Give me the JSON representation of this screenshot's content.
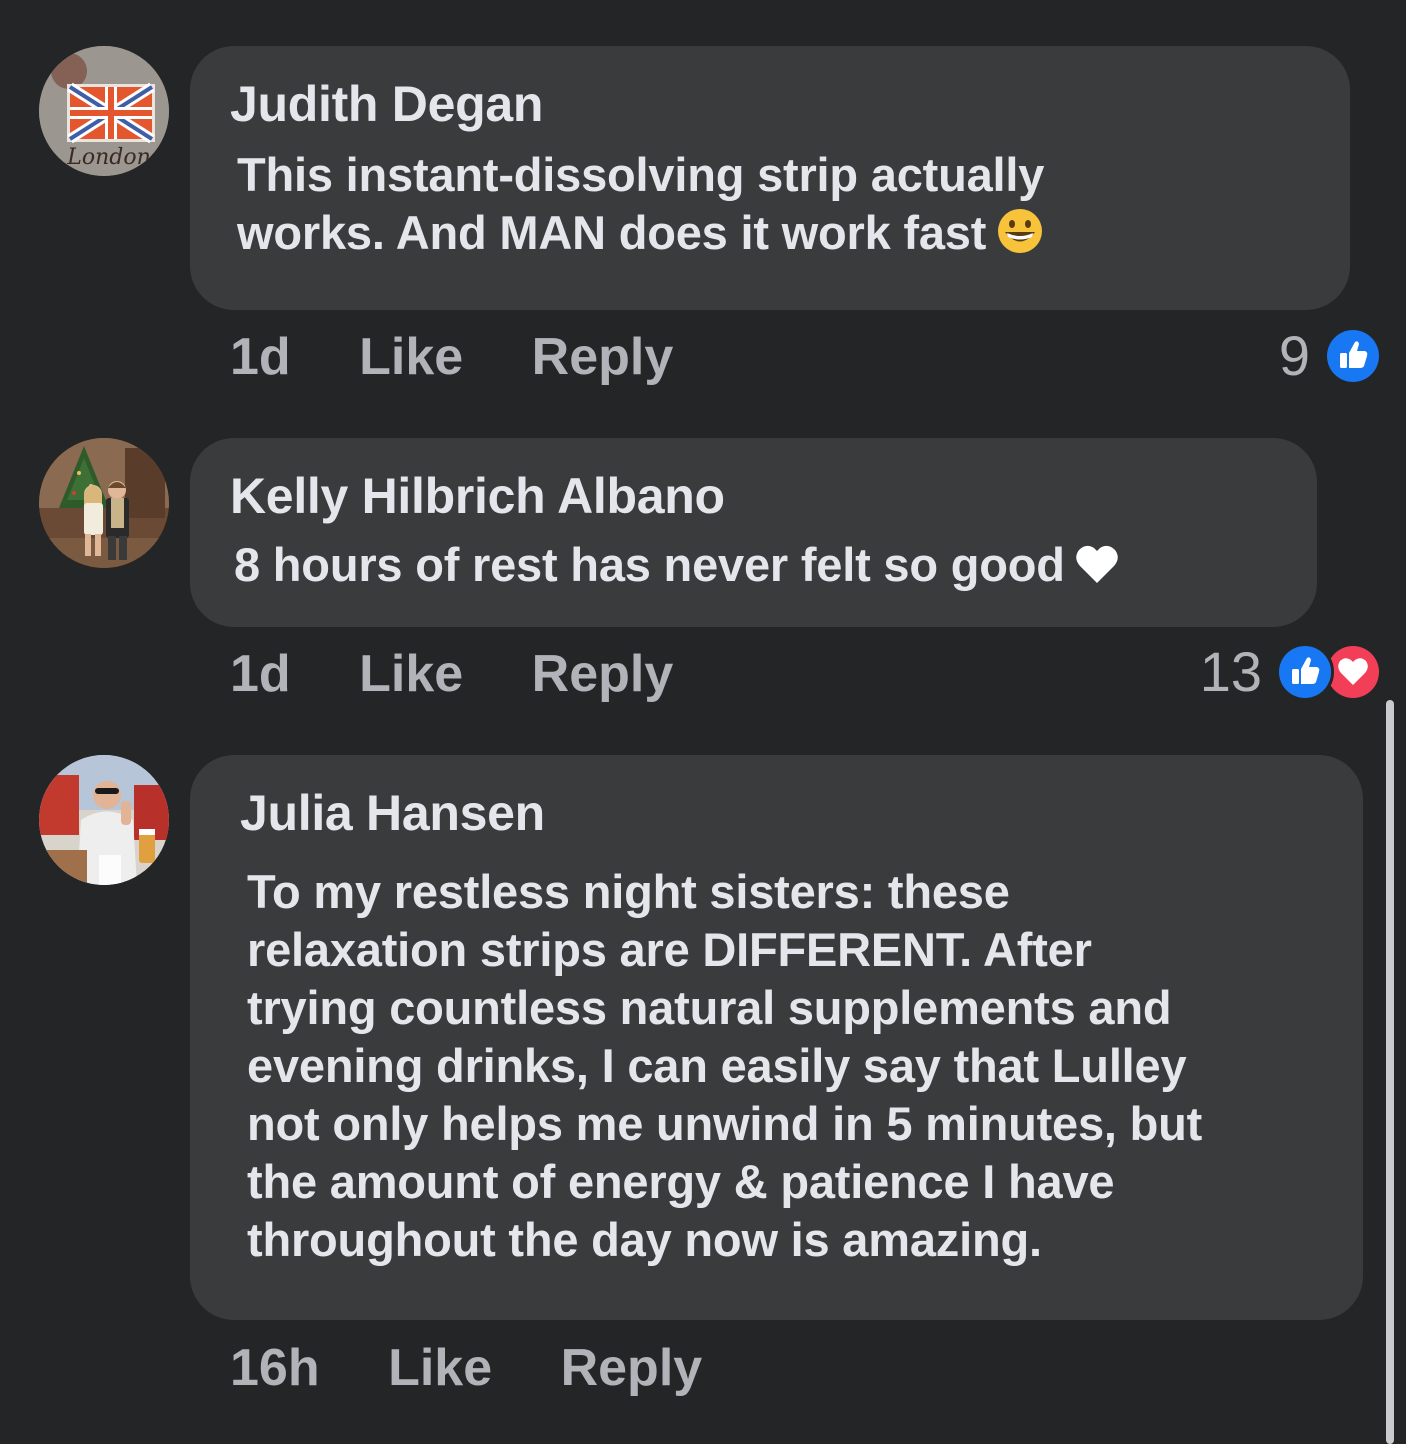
{
  "comments": [
    {
      "author": "Judith Degan",
      "avatar_text": "London",
      "text_lines": [
        "This instant-dissolving strip actually",
        "works. And MAN does it work fast"
      ],
      "inline_emoji": "grinning-face-icon",
      "time": "1d",
      "like_label": "Like",
      "reply_label": "Reply",
      "reaction_count": "9",
      "reactions": [
        "like"
      ]
    },
    {
      "author": "Kelly Hilbrich Albano",
      "text_lines": [
        "8 hours of rest has never felt so good"
      ],
      "inline_emoji": "white-heart-icon",
      "time": "1d",
      "like_label": "Like",
      "reply_label": "Reply",
      "reaction_count": "13",
      "reactions": [
        "like",
        "love"
      ]
    },
    {
      "author": "Julia Hansen",
      "text_lines": [
        "To my restless night sisters: these",
        "relaxation strips are DIFFERENT. After",
        "trying countless natural supplements and",
        "evening drinks, I can easily say that Lulley",
        "not only helps me unwind in 5 minutes, but",
        "the amount of energy & patience I have",
        "throughout the day now is amazing."
      ],
      "time": "16h",
      "like_label": "Like",
      "reply_label": "Reply"
    }
  ],
  "colors": {
    "background": "#242526",
    "bubble": "#3a3b3c",
    "primary_text": "#e4e6eb",
    "secondary_text": "#b0b3b8",
    "like_blue": "#1877f2",
    "love_red": "#f33e58"
  }
}
